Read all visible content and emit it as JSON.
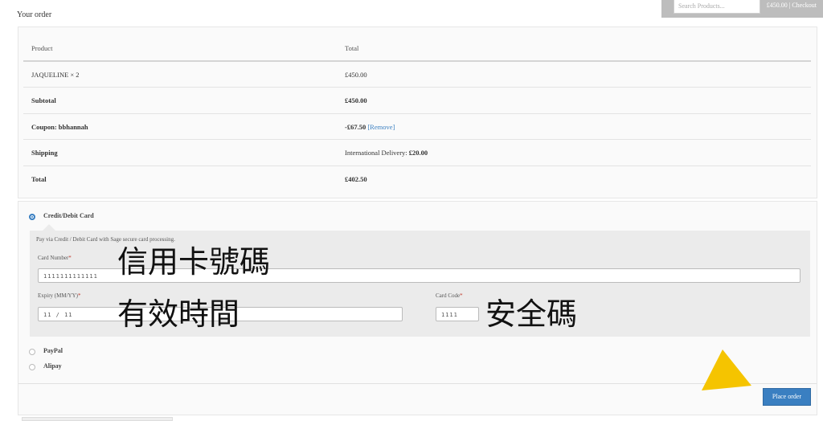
{
  "header": {
    "search_placeholder": "Search Products...",
    "cart_summary": "£450.00 | Checkout"
  },
  "order": {
    "heading": "Your order",
    "columns": {
      "product": "Product",
      "total": "Total"
    },
    "rows": [
      {
        "label": "JAQUELINE  × 2",
        "value": "£450.00"
      },
      {
        "label": "Subtotal",
        "value": "£450.00"
      },
      {
        "label": "Coupon: bbhannah",
        "value": "-£67.50",
        "link": "[Remove]"
      },
      {
        "label": "Shipping",
        "value_prefix": "International Delivery:",
        "value": "£20.00"
      },
      {
        "label": "Total",
        "value": "£402.50"
      }
    ]
  },
  "payment": {
    "methods": [
      {
        "label": "Credit/Debit Card",
        "selected": true
      },
      {
        "label": "PayPal",
        "selected": false
      },
      {
        "label": "Alipay",
        "selected": false
      }
    ],
    "card": {
      "description": "Pay via Credit / Debit Card with Sage secure card processing.",
      "card_number_label": "Card Number",
      "card_number_value": "1111111111111",
      "expiry_label": "Expiry (MM/YY)",
      "expiry_value": "11 / 11",
      "card_code_label": "Card Code",
      "card_code_value": "1111",
      "required_mark": "*"
    },
    "place_order_label": "Place order"
  },
  "annotations": {
    "card_number": "信用卡號碼",
    "expiry": "有效時間",
    "card_code": "安全碼",
    "arrow_color": "#f5c400"
  },
  "colors": {
    "accent": "#3a7fc1",
    "required": "#c0392b"
  }
}
